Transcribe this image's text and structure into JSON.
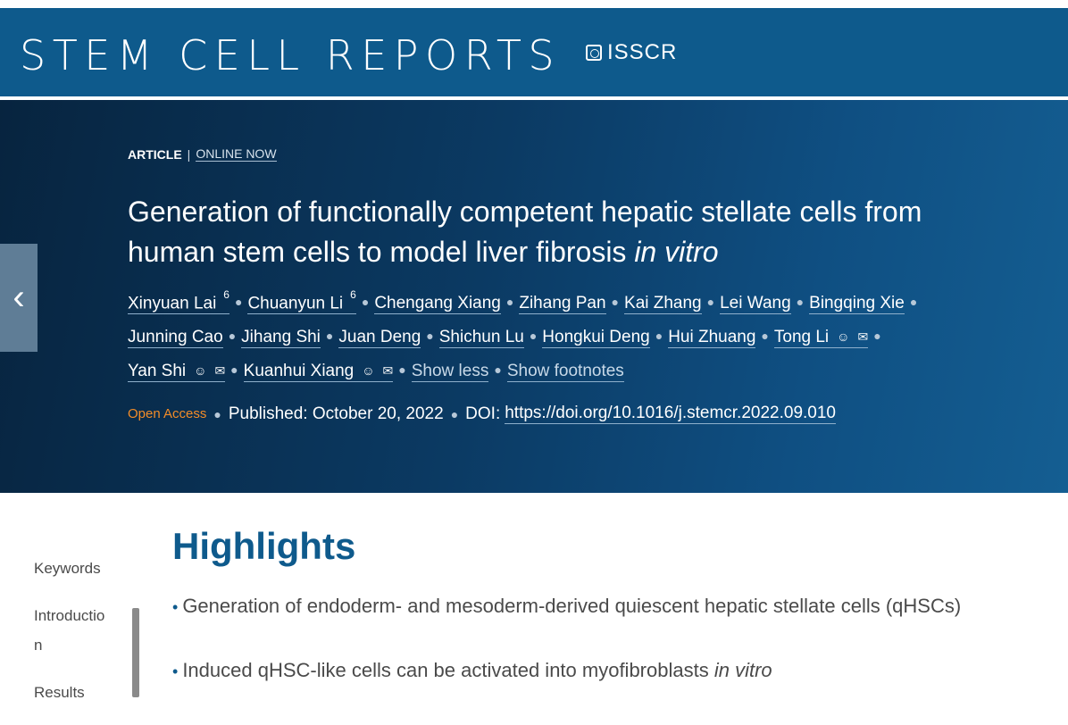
{
  "header": {
    "journal_title": "STEM CELL REPORTS",
    "society": "ISSCR",
    "brand_color": "#0e5a8c"
  },
  "article": {
    "type": "ARTICLE",
    "status": "ONLINE NOW",
    "title_main": "Generation of functionally competent hepatic stellate cells from human stem cells to model liver fibrosis ",
    "title_italic": "in vitro",
    "authors": [
      {
        "name": "Xinyuan Lai",
        "sup": "6"
      },
      {
        "name": "Chuanyun Li",
        "sup": "6"
      },
      {
        "name": "Chengang Xiang"
      },
      {
        "name": "Zihang Pan"
      },
      {
        "name": "Kai Zhang"
      },
      {
        "name": "Lei Wang"
      },
      {
        "name": "Bingqing Xie"
      },
      {
        "name": "Junning Cao"
      },
      {
        "name": "Jihang Shi"
      },
      {
        "name": "Juan Deng"
      },
      {
        "name": "Shichun Lu"
      },
      {
        "name": "Hongkui Deng"
      },
      {
        "name": "Hui Zhuang"
      },
      {
        "name": "Tong Li"
      },
      {
        "name": "Yan Shi"
      },
      {
        "name": "Kuanhui Xiang"
      }
    ],
    "show_less": "Show less",
    "show_footnotes": "Show footnotes",
    "open_access": "Open Access",
    "published": "Published: October 20, 2022",
    "doi_label": "DOI:",
    "doi_url": "https://doi.org/10.1016/j.stemcr.2022.09.010",
    "open_access_color": "#f28c28"
  },
  "sidebar": {
    "items": [
      "Keywords",
      "Introductio n",
      "Results"
    ]
  },
  "highlights": {
    "heading": "Highlights",
    "items": [
      {
        "text": "Generation of endoderm- and mesoderm-derived quiescent hepatic stellate cells (qHSCs)",
        "italic": ""
      },
      {
        "text": "Induced qHSC-like cells can be activated into myofibroblasts ",
        "italic": "in vitro"
      }
    ]
  }
}
